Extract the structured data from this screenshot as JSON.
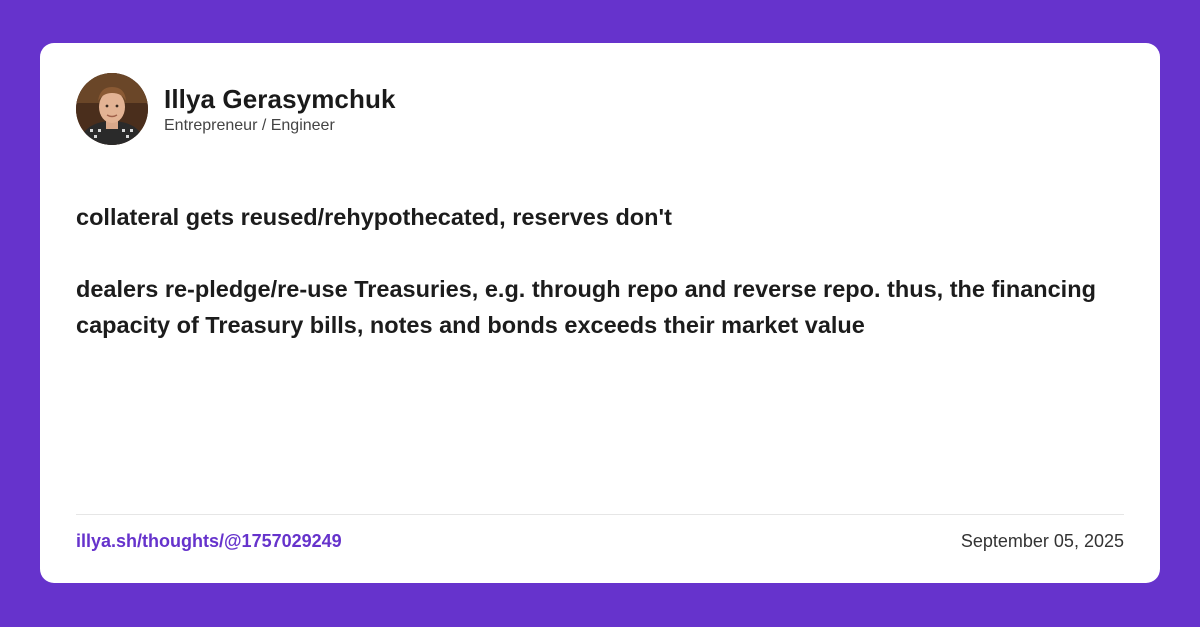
{
  "colors": {
    "background": "#6633cc",
    "card": "#ffffff",
    "accent_link": "#6633cc",
    "text_primary": "#1c1c1c",
    "text_secondary": "#444444"
  },
  "author": {
    "name": "Illya Gerasymchuk",
    "title": "Entrepreneur / Engineer",
    "avatar_icon": "profile-photo"
  },
  "post": {
    "paragraphs": [
      "collateral gets reused/rehypothecated, reserves don't",
      "dealers re-pledge/re-use Treasuries, e.g. through repo and reverse repo. thus, the financing capacity of Treasury bills, notes and bonds exceeds their market value"
    ]
  },
  "footer": {
    "link": "illya.sh/thoughts/@1757029249",
    "date": "September 05, 2025"
  }
}
